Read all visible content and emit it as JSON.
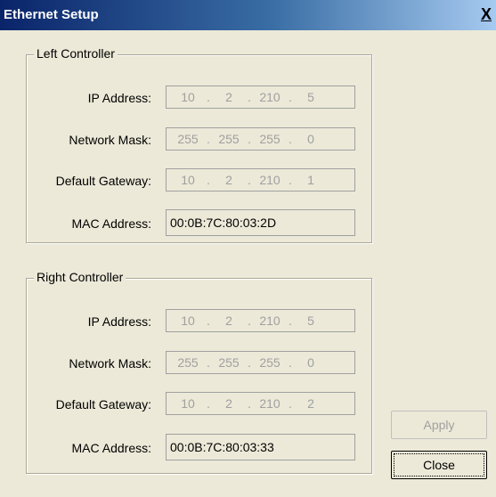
{
  "window": {
    "title": "Ethernet Setup",
    "close_glyph": "X"
  },
  "left": {
    "title": "Left Controller",
    "ip_label": "IP Address:",
    "ip": [
      "10",
      "2",
      "210",
      "5"
    ],
    "mask_label": "Network Mask:",
    "mask": [
      "255",
      "255",
      "255",
      "0"
    ],
    "gw_label": "Default Gateway:",
    "gw": [
      "10",
      "2",
      "210",
      "1"
    ],
    "mac_label": "MAC Address:",
    "mac": "00:0B:7C:80:03:2D"
  },
  "right": {
    "title": "Right Controller",
    "ip_label": "IP Address:",
    "ip": [
      "10",
      "2",
      "210",
      "5"
    ],
    "mask_label": "Network Mask:",
    "mask": [
      "255",
      "255",
      "255",
      "0"
    ],
    "gw_label": "Default Gateway:",
    "gw": [
      "10",
      "2",
      "210",
      "2"
    ],
    "mac_label": "MAC Address:",
    "mac": "00:0B:7C:80:03:33"
  },
  "buttons": {
    "apply": "Apply",
    "close": "Close"
  }
}
